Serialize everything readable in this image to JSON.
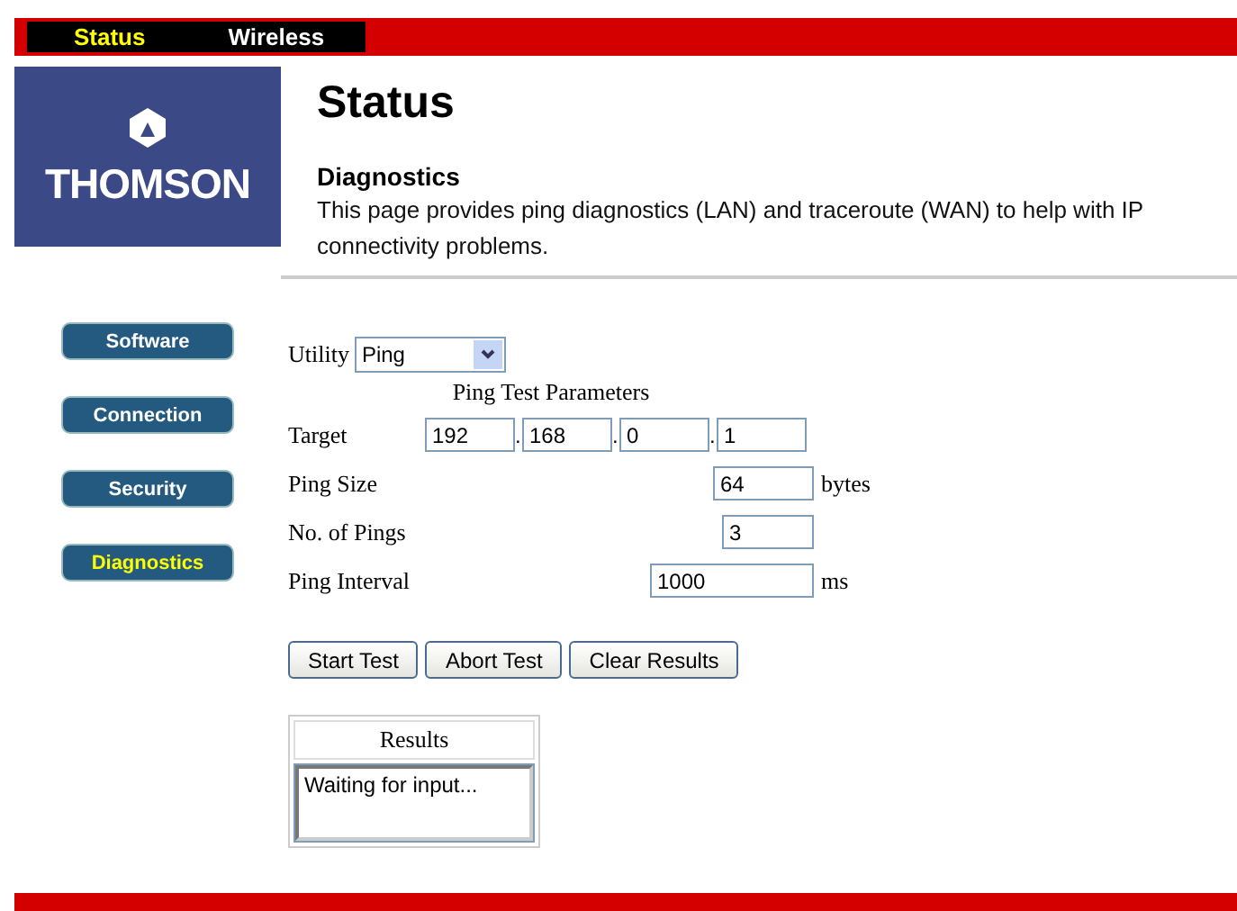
{
  "tabs": [
    {
      "label": "Status",
      "selected": true
    },
    {
      "label": "Wireless",
      "selected": false
    }
  ],
  "logo": {
    "text": "THOMSON"
  },
  "sidebar": {
    "items": [
      {
        "label": "Software",
        "selected": false
      },
      {
        "label": "Connection",
        "selected": false
      },
      {
        "label": "Security",
        "selected": false
      },
      {
        "label": "Diagnostics",
        "selected": true
      }
    ]
  },
  "page": {
    "title": "Status",
    "section": "Diagnostics",
    "description": "This page provides ping diagnostics (LAN) and traceroute (WAN) to help with IP connectivity problems."
  },
  "utility": {
    "label": "Utility",
    "value": "Ping"
  },
  "parameters": {
    "heading": "Ping Test Parameters",
    "target": {
      "label": "Target",
      "octets": [
        "192",
        "168",
        "0",
        "1"
      ],
      "separator": "."
    },
    "rows": [
      {
        "label": "Ping Size",
        "value": "64",
        "unit": "bytes"
      },
      {
        "label": "No. of Pings",
        "value": "3"
      },
      {
        "label": "Ping Interval",
        "value": "1000",
        "unit": "ms"
      }
    ]
  },
  "buttons": [
    "Start Test",
    "Abort Test",
    "Clear Results"
  ],
  "results": {
    "heading": "Results",
    "text": "Waiting for input..."
  }
}
